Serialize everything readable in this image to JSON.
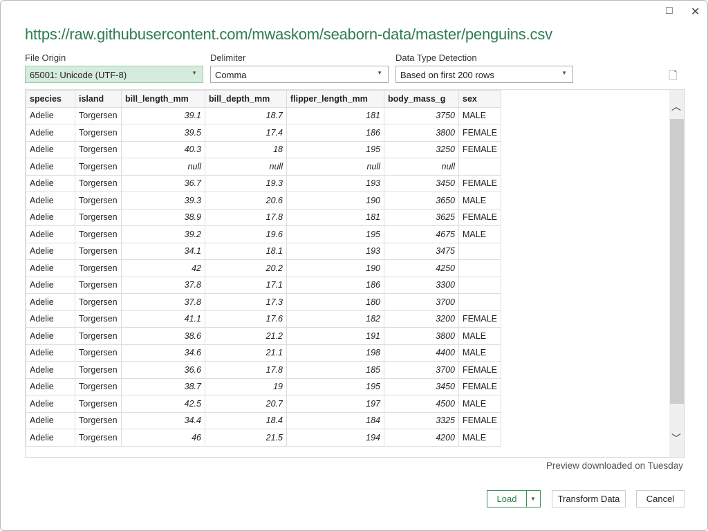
{
  "window": {
    "restore_icon": "□",
    "close_icon": "✕"
  },
  "title": "https://raw.githubusercontent.com/mwaskom/seaborn-data/master/penguins.csv",
  "file_origin": {
    "label": "File Origin",
    "value": "65001: Unicode (UTF-8)"
  },
  "delimiter": {
    "label": "Delimiter",
    "value": "Comma"
  },
  "detection": {
    "label": "Data Type Detection",
    "value": "Based on first 200 rows"
  },
  "columns": [
    "species",
    "island",
    "bill_length_mm",
    "bill_depth_mm",
    "flipper_length_mm",
    "body_mass_g",
    "sex"
  ],
  "rows": [
    [
      "Adelie",
      "Torgersen",
      "39.1",
      "18.7",
      "181",
      "3750",
      "MALE"
    ],
    [
      "Adelie",
      "Torgersen",
      "39.5",
      "17.4",
      "186",
      "3800",
      "FEMALE"
    ],
    [
      "Adelie",
      "Torgersen",
      "40.3",
      "18",
      "195",
      "3250",
      "FEMALE"
    ],
    [
      "Adelie",
      "Torgersen",
      "null",
      "null",
      "null",
      "null",
      ""
    ],
    [
      "Adelie",
      "Torgersen",
      "36.7",
      "19.3",
      "193",
      "3450",
      "FEMALE"
    ],
    [
      "Adelie",
      "Torgersen",
      "39.3",
      "20.6",
      "190",
      "3650",
      "MALE"
    ],
    [
      "Adelie",
      "Torgersen",
      "38.9",
      "17.8",
      "181",
      "3625",
      "FEMALE"
    ],
    [
      "Adelie",
      "Torgersen",
      "39.2",
      "19.6",
      "195",
      "4675",
      "MALE"
    ],
    [
      "Adelie",
      "Torgersen",
      "34.1",
      "18.1",
      "193",
      "3475",
      ""
    ],
    [
      "Adelie",
      "Torgersen",
      "42",
      "20.2",
      "190",
      "4250",
      ""
    ],
    [
      "Adelie",
      "Torgersen",
      "37.8",
      "17.1",
      "186",
      "3300",
      ""
    ],
    [
      "Adelie",
      "Torgersen",
      "37.8",
      "17.3",
      "180",
      "3700",
      ""
    ],
    [
      "Adelie",
      "Torgersen",
      "41.1",
      "17.6",
      "182",
      "3200",
      "FEMALE"
    ],
    [
      "Adelie",
      "Torgersen",
      "38.6",
      "21.2",
      "191",
      "3800",
      "MALE"
    ],
    [
      "Adelie",
      "Torgersen",
      "34.6",
      "21.1",
      "198",
      "4400",
      "MALE"
    ],
    [
      "Adelie",
      "Torgersen",
      "36.6",
      "17.8",
      "185",
      "3700",
      "FEMALE"
    ],
    [
      "Adelie",
      "Torgersen",
      "38.7",
      "19",
      "195",
      "3450",
      "FEMALE"
    ],
    [
      "Adelie",
      "Torgersen",
      "42.5",
      "20.7",
      "197",
      "4500",
      "MALE"
    ],
    [
      "Adelie",
      "Torgersen",
      "34.4",
      "18.4",
      "184",
      "3325",
      "FEMALE"
    ],
    [
      "Adelie",
      "Torgersen",
      "46",
      "21.5",
      "194",
      "4200",
      "MALE"
    ]
  ],
  "status": "Preview downloaded on Tuesday",
  "buttons": {
    "load": "Load",
    "transform": "Transform Data",
    "cancel": "Cancel"
  }
}
